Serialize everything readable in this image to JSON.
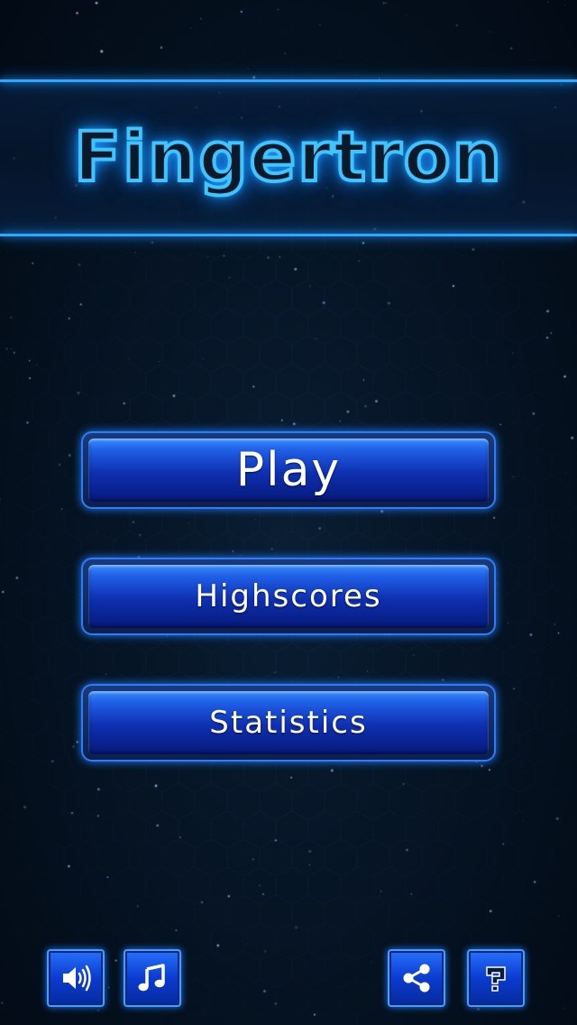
{
  "title": "Fingertron",
  "menu": {
    "play": "Play",
    "highscores": "Highscores",
    "statistics": "Statistics"
  },
  "icons": {
    "sound": "speaker-icon",
    "music": "music-note-icon",
    "share": "share-icon",
    "help": "question-mark-icon"
  },
  "colors": {
    "accent": "#2aa9ff",
    "button": "#0e2fb0",
    "background": "#061424"
  }
}
